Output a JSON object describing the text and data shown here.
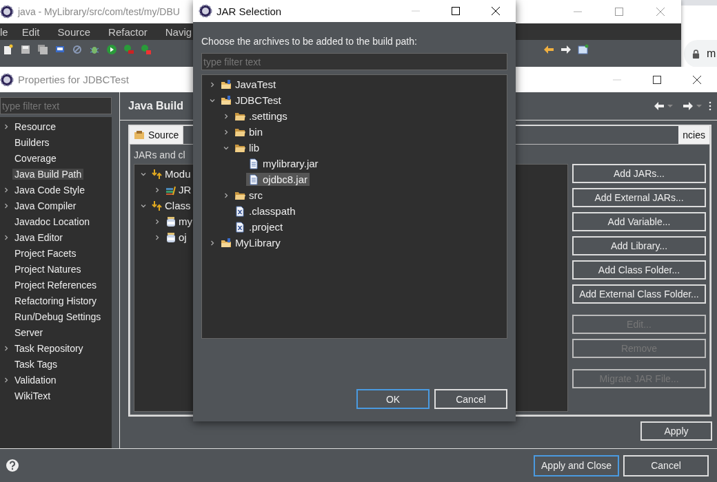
{
  "background_window": {
    "title": "java - MyLibrary/src/com/test/my/DBU",
    "menu": [
      "le",
      "Edit",
      "Source",
      "Refactor",
      "Navig"
    ]
  },
  "browser": {
    "address": "m"
  },
  "properties_window": {
    "title": "Properties for JDBCTest",
    "filter": {
      "placeholder": "type filter text"
    },
    "categories": [
      {
        "label": "Resource",
        "expandable": true,
        "selected": false
      },
      {
        "label": "Builders",
        "expandable": false,
        "selected": false
      },
      {
        "label": "Coverage",
        "expandable": false,
        "selected": false
      },
      {
        "label": "Java Build Path",
        "expandable": false,
        "selected": true
      },
      {
        "label": "Java Code Style",
        "expandable": true,
        "selected": false
      },
      {
        "label": "Java Compiler",
        "expandable": true,
        "selected": false
      },
      {
        "label": "Javadoc Location",
        "expandable": false,
        "selected": false
      },
      {
        "label": "Java Editor",
        "expandable": true,
        "selected": false
      },
      {
        "label": "Project Facets",
        "expandable": false,
        "selected": false
      },
      {
        "label": "Project Natures",
        "expandable": false,
        "selected": false
      },
      {
        "label": "Project References",
        "expandable": false,
        "selected": false
      },
      {
        "label": "Refactoring History",
        "expandable": false,
        "selected": false
      },
      {
        "label": "Run/Debug Settings",
        "expandable": false,
        "selected": false
      },
      {
        "label": "Server",
        "expandable": false,
        "selected": false
      },
      {
        "label": "Task Repository",
        "expandable": true,
        "selected": false
      },
      {
        "label": "Task Tags",
        "expandable": false,
        "selected": false
      },
      {
        "label": "Validation",
        "expandable": true,
        "selected": false
      },
      {
        "label": "WikiText",
        "expandable": false,
        "selected": false
      }
    ],
    "page_title": "Java Build",
    "tabs": [
      {
        "label": "Source",
        "kind": "source"
      },
      {
        "label": "ncies",
        "kind": "text"
      }
    ],
    "description": "JARs and cl",
    "entries": [
      {
        "label": "Modu",
        "kind": "path",
        "expanded": true,
        "children": [
          {
            "label": "JR",
            "kind": "library",
            "expanded": false
          }
        ]
      },
      {
        "label": "Class",
        "kind": "path",
        "expanded": true,
        "children": [
          {
            "label": "my",
            "kind": "jar",
            "expanded": false
          },
          {
            "label": "oj",
            "kind": "jar",
            "expanded": false
          }
        ]
      }
    ],
    "buttons": [
      {
        "label": "Add JARs...",
        "disabled": false
      },
      {
        "label": "Add External JARs...",
        "disabled": false
      },
      {
        "label": "Add Variable...",
        "disabled": false
      },
      {
        "label": "Add Library...",
        "disabled": false
      },
      {
        "label": "Add Class Folder...",
        "disabled": false
      },
      {
        "label": "Add External Class Folder...",
        "disabled": false
      },
      {
        "label": "Edit...",
        "disabled": true
      },
      {
        "label": "Remove",
        "disabled": true
      },
      {
        "label": "Migrate JAR File...",
        "disabled": true
      }
    ],
    "apply": "Apply",
    "footer_buttons": [
      {
        "label": "Apply and Close",
        "default": true
      },
      {
        "label": "Cancel",
        "default": false
      }
    ]
  },
  "jar_dialog": {
    "title": "JAR Selection",
    "prompt": "Choose the archives to be added to the build path:",
    "filter": {
      "placeholder": "type filter text"
    },
    "tree": [
      {
        "label": "JavaTest",
        "kind": "project",
        "expanded": false,
        "selected": false
      },
      {
        "label": "JDBCTest",
        "kind": "project",
        "expanded": true,
        "selected": false,
        "children": [
          {
            "label": ".settings",
            "kind": "folder",
            "expanded": false,
            "selected": false
          },
          {
            "label": "bin",
            "kind": "folder",
            "expanded": false,
            "selected": false
          },
          {
            "label": "lib",
            "kind": "folder",
            "expanded": true,
            "selected": false,
            "children": [
              {
                "label": "mylibrary.jar",
                "kind": "file",
                "selected": false
              },
              {
                "label": "ojdbc8.jar",
                "kind": "file",
                "selected": true
              }
            ]
          },
          {
            "label": "src",
            "kind": "folder",
            "expanded": false,
            "selected": false
          },
          {
            "label": ".classpath",
            "kind": "xml",
            "selected": false
          },
          {
            "label": ".project",
            "kind": "xml",
            "selected": false
          }
        ]
      },
      {
        "label": "MyLibrary",
        "kind": "project",
        "expanded": false,
        "selected": false
      }
    ],
    "buttons": [
      {
        "label": "OK",
        "default": true
      },
      {
        "label": "Cancel",
        "default": false
      }
    ]
  }
}
